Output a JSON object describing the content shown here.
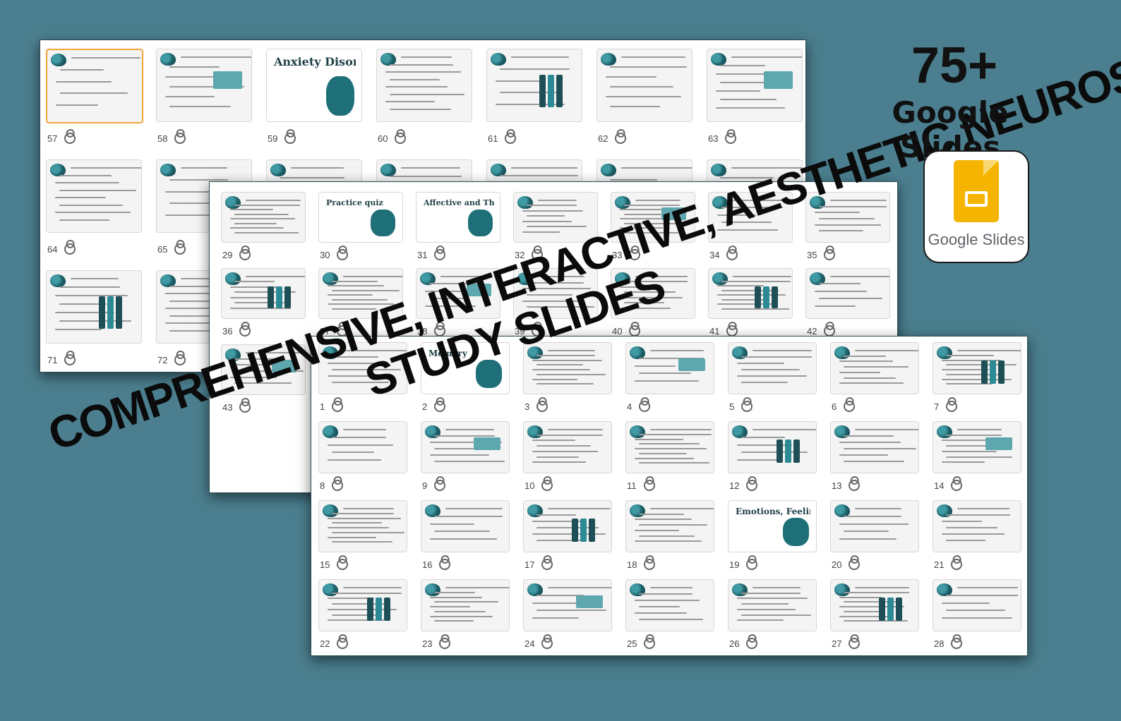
{
  "promo": {
    "count": "75+",
    "label": "Google Slides",
    "logo_text": "Google Slides",
    "logo_icon": "google-slides-icon",
    "colors": {
      "background": "#4b7f8f",
      "logo_yellow": "#f5b400",
      "selected_border": "#f2a43a"
    }
  },
  "headline": {
    "line1": "COMPREHENSIVE, INTERACTIVE, AESTHETIC NEUROSCIENCE",
    "line2": "STUDY SLIDES"
  },
  "panels": {
    "back": {
      "slides": [
        {
          "number": "57",
          "selected": true
        },
        {
          "number": "58"
        },
        {
          "number": "59",
          "title": "Anxiety Disorders"
        },
        {
          "number": "60"
        },
        {
          "number": "61"
        },
        {
          "number": "62"
        },
        {
          "number": "63"
        },
        {
          "number": "64"
        },
        {
          "number": "65"
        },
        {
          "number": ""
        },
        {
          "number": ""
        },
        {
          "number": ""
        },
        {
          "number": ""
        },
        {
          "number": ""
        },
        {
          "number": "71"
        },
        {
          "number": "72"
        }
      ]
    },
    "mid": {
      "slides": [
        {
          "number": "29"
        },
        {
          "number": "30",
          "title": "Practice quiz"
        },
        {
          "number": "31",
          "title": "Affective and Thought Disorders"
        },
        {
          "number": "32"
        },
        {
          "number": "33"
        },
        {
          "number": "34"
        },
        {
          "number": "35"
        },
        {
          "number": "36"
        },
        {
          "number": "37"
        },
        {
          "number": "38"
        },
        {
          "number": "39"
        },
        {
          "number": "40"
        },
        {
          "number": "41"
        },
        {
          "number": "42"
        },
        {
          "number": "43"
        },
        {
          "number": ""
        }
      ]
    },
    "front": {
      "slides": [
        {
          "number": "1"
        },
        {
          "number": "2",
          "title": "Memory"
        },
        {
          "number": "3"
        },
        {
          "number": "4"
        },
        {
          "number": "5"
        },
        {
          "number": "6"
        },
        {
          "number": "7"
        },
        {
          "number": "8"
        },
        {
          "number": "9"
        },
        {
          "number": "10"
        },
        {
          "number": "11"
        },
        {
          "number": "12"
        },
        {
          "number": "13"
        },
        {
          "number": "14"
        },
        {
          "number": "15"
        },
        {
          "number": "16"
        },
        {
          "number": "17"
        },
        {
          "number": "18"
        },
        {
          "number": "19",
          "title": "Emotions, Feelings and Decision-making"
        },
        {
          "number": "20"
        },
        {
          "number": "21"
        },
        {
          "number": "22"
        },
        {
          "number": "23"
        },
        {
          "number": "24"
        },
        {
          "number": "25"
        },
        {
          "number": "26"
        },
        {
          "number": "27"
        },
        {
          "number": "28"
        }
      ]
    }
  }
}
